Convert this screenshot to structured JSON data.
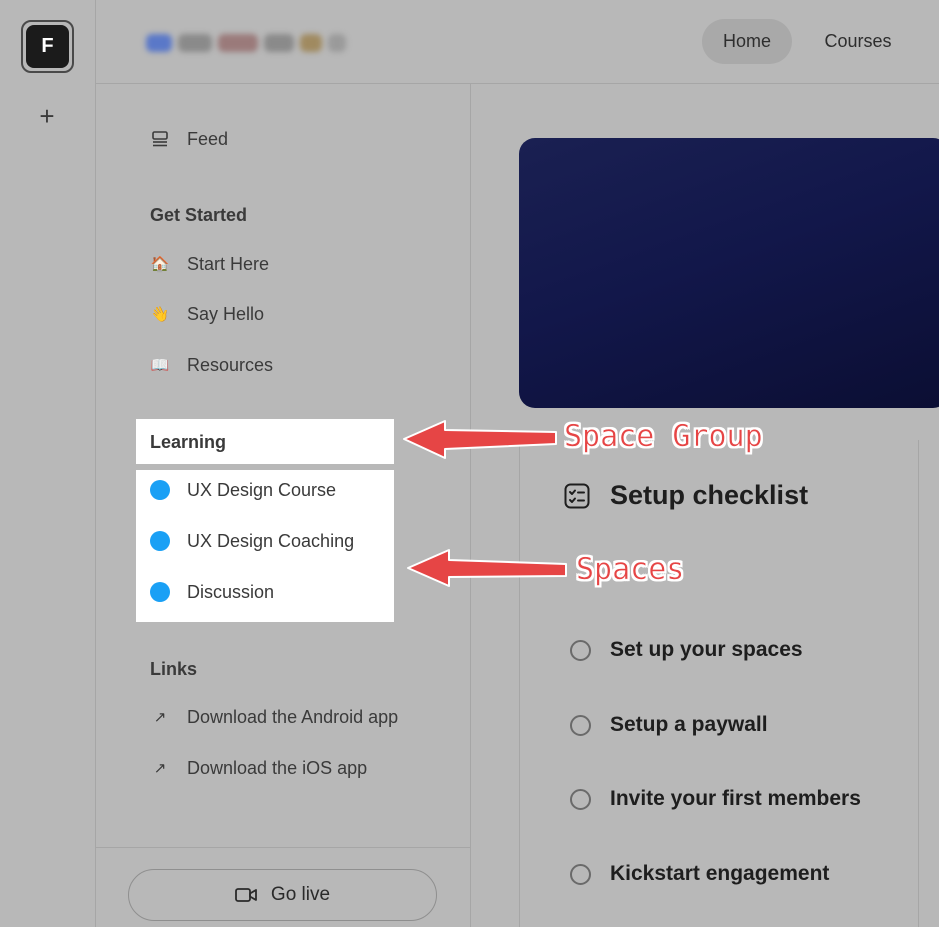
{
  "workspace": {
    "initial": "F",
    "add_symbol": "+"
  },
  "header": {
    "nav": {
      "home_label": "Home",
      "courses_label": "Courses"
    }
  },
  "sidebar": {
    "feed_label": "Feed",
    "get_started": {
      "heading": "Get Started",
      "items": [
        {
          "icon": "house-emoji-icon",
          "glyph": "🏠",
          "label": "Start Here"
        },
        {
          "icon": "wave-emoji-icon",
          "glyph": "👋",
          "label": "Say Hello"
        },
        {
          "icon": "book-emoji-icon",
          "glyph": "📖",
          "label": "Resources"
        }
      ]
    },
    "learning": {
      "heading": "Learning",
      "items": [
        {
          "label": "UX Design Course"
        },
        {
          "label": "UX Design Coaching"
        },
        {
          "label": "Discussion"
        }
      ]
    },
    "links": {
      "heading": "Links",
      "items": [
        {
          "icon": "arrow-up-right-icon",
          "glyph": "↗",
          "label": "Download the Android app"
        },
        {
          "icon": "arrow-up-right-icon",
          "glyph": "↗",
          "label": "Download the iOS app"
        }
      ]
    },
    "go_live_label": "Go live"
  },
  "checklist": {
    "title": "Setup checklist",
    "tasks": [
      {
        "label": "Set up your spaces"
      },
      {
        "label": "Setup a paywall"
      },
      {
        "label": "Invite your first members"
      },
      {
        "label": "Kickstart engagement"
      }
    ]
  },
  "annotations": {
    "space_group": "Space Group",
    "spaces": "Spaces"
  },
  "colors": {
    "space_dot": "#1aa0f5",
    "annotation": "#e64545",
    "banner_dark": "#0b0e33"
  }
}
